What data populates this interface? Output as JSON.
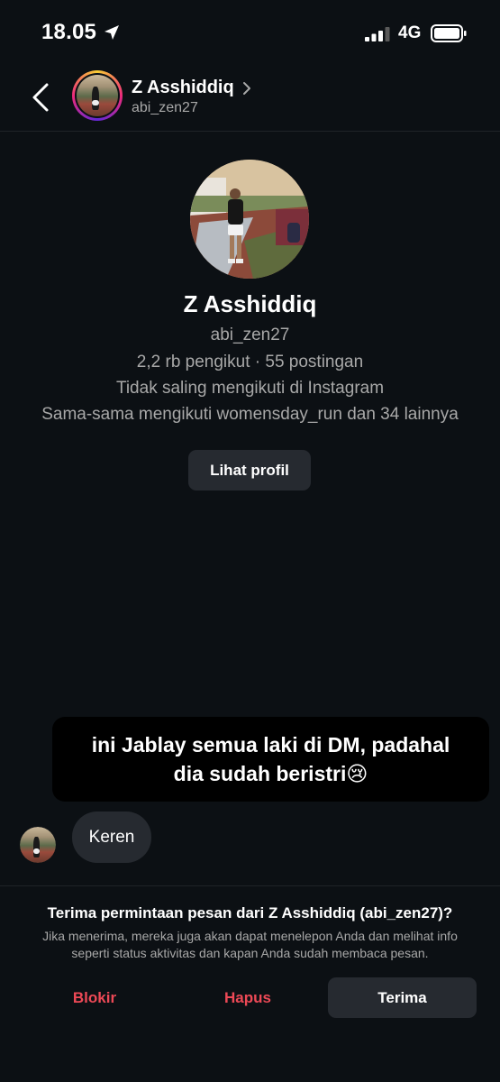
{
  "status_bar": {
    "time": "18.05",
    "network": "4G"
  },
  "header": {
    "name": "Z Asshiddiq",
    "username": "abi_zen27"
  },
  "profile": {
    "name": "Z Asshiddiq",
    "username": "abi_zen27",
    "stats": "2,2 rb pengikut · 55 postingan",
    "follow_status": "Tidak saling mengikuti di Instagram",
    "mutual": "Sama-sama mengikuti womensday_run dan 34 lainnya",
    "view_button": "Lihat profil"
  },
  "overlay_caption": {
    "line1": "ini Jablay semua laki di DM, padahal",
    "line2": "dia sudah beristri😢"
  },
  "message": {
    "text": "Keren"
  },
  "request": {
    "title": "Terima permintaan pesan dari Z Asshiddiq (abi_zen27)?",
    "description": "Jika menerima, mereka juga akan dapat menelepon Anda dan melihat info seperti status aktivitas dan kapan Anda sudah membaca pesan.",
    "block_label": "Blokir",
    "delete_label": "Hapus",
    "accept_label": "Terima"
  },
  "colors": {
    "background": "#0c1014",
    "danger": "#ed4956",
    "button_bg": "#262a30",
    "muted_text": "#a8a8a8"
  }
}
